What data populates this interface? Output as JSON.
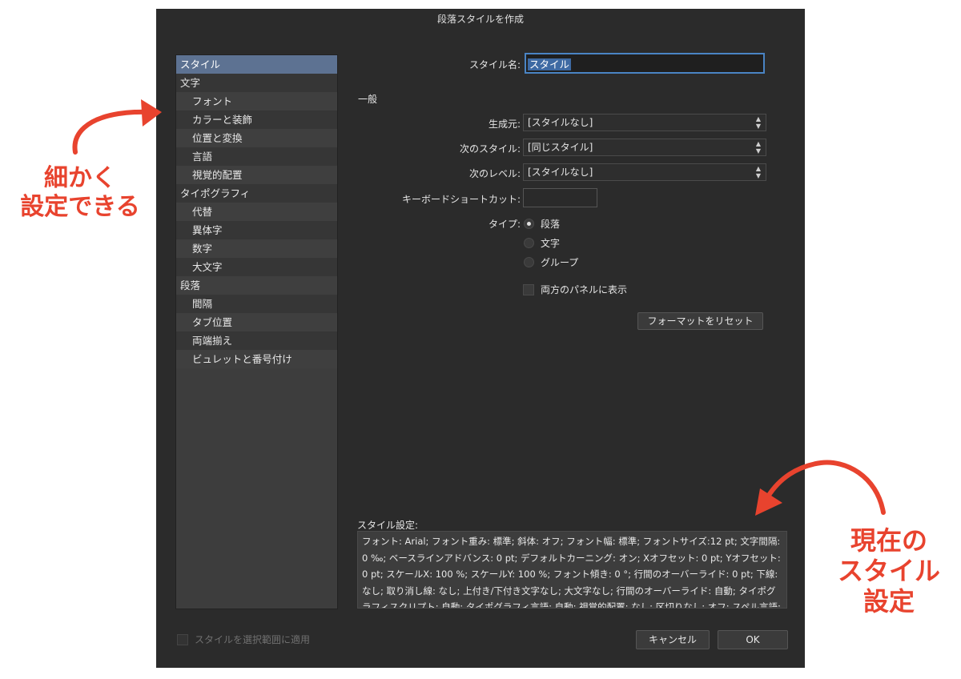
{
  "dialog": {
    "title": "段落スタイルを作成"
  },
  "sidebar": {
    "items": [
      {
        "label": "スタイル",
        "level": 0,
        "selected": true
      },
      {
        "label": "文字",
        "level": 0
      },
      {
        "label": "フォント",
        "level": 1
      },
      {
        "label": "カラーと装飾",
        "level": 1
      },
      {
        "label": "位置と変換",
        "level": 1
      },
      {
        "label": "言語",
        "level": 1
      },
      {
        "label": "視覚的配置",
        "level": 1
      },
      {
        "label": "タイポグラフィ",
        "level": 0
      },
      {
        "label": "代替",
        "level": 1
      },
      {
        "label": "異体字",
        "level": 1
      },
      {
        "label": "数字",
        "level": 1
      },
      {
        "label": "大文字",
        "level": 1
      },
      {
        "label": "段落",
        "level": 0
      },
      {
        "label": "間隔",
        "level": 1
      },
      {
        "label": "タブ位置",
        "level": 1
      },
      {
        "label": "両端揃え",
        "level": 1
      },
      {
        "label": "ビュレットと番号付け",
        "level": 1
      }
    ]
  },
  "form": {
    "style_name_label": "スタイル名:",
    "style_name_value": "スタイル",
    "general_section": "一般",
    "based_on_label": "生成元:",
    "based_on_value": "[スタイルなし]",
    "next_style_label": "次のスタイル:",
    "next_style_value": "[同じスタイル]",
    "next_level_label": "次のレベル:",
    "next_level_value": "[スタイルなし]",
    "shortcut_label": "キーボードショートカット:",
    "shortcut_value": "",
    "type_label": "タイプ:",
    "type_options": [
      "段落",
      "文字",
      "グループ"
    ],
    "type_selected": "段落",
    "show_both_panels_label": "両方のパネルに表示",
    "reset_format_button": "フォーマットをリセット",
    "style_settings_label": "スタイル設定:",
    "style_settings_text": "フォント: Arial; フォント重み: 標準; 斜体: オフ; フォント幅: 標準; フォントサイズ:12 pt; 文字間隔: 0 ‰; ベースラインアドバンス: 0 pt; デフォルトカーニング: オン; Xオフセット: 0 pt; Yオフセット: 0 pt; スケールX: 100 %; スケールY: 100 %; フォント傾き: 0 °; 行間のオーバーライド: 0 pt; 下線: なし; 取り消し線: なし; 上付き/下付き文字なし; 大文字なし; 行間のオーバーライド: 自動; タイポグラフィスクリプト: 自動; タイポグラフィ言語: 自動; 視覚的配置: なし; 区切りなし; オフ; スペル言語: 日本語 (日本); ハイフネーション言語: 自動; 文字送り"
  },
  "footer": {
    "apply_to_selection_label": "スタイルを選択範囲に適用",
    "cancel_button": "キャンセル",
    "ok_button": "OK"
  },
  "annotations": {
    "left_line1": "細かく",
    "left_line2": "設定できる",
    "right_line1": "現在の",
    "right_line2": "スタイル",
    "right_line3": "設定",
    "color": "#e8432e"
  }
}
